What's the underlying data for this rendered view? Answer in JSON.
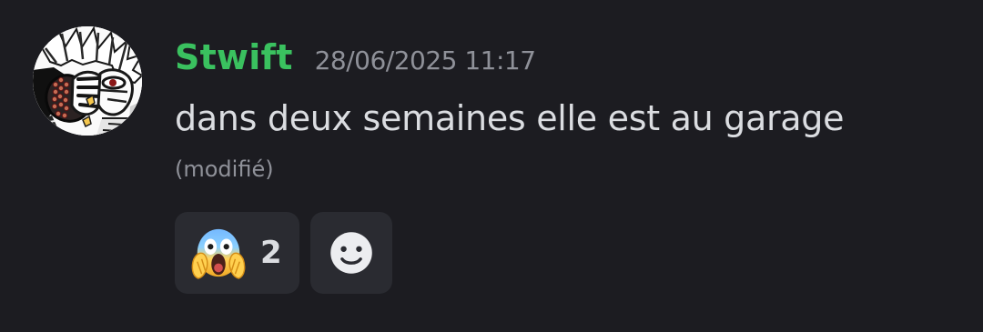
{
  "message": {
    "author": "Stwift",
    "timestamp": "28/06/2025 11:17",
    "text": "dans deux semaines elle est au garage",
    "edited_label": "(modifié)",
    "avatar_icon": "manga-avatar-icon"
  },
  "reactions": [
    {
      "emoji": "screaming-face-icon",
      "count": "2"
    }
  ],
  "add_reaction": {
    "icon": "add-reaction-smile-icon"
  },
  "colors": {
    "background": "#1c1c21",
    "username": "#3ac15f",
    "text": "#dbdde1",
    "muted": "#8f9199",
    "reaction_background": "#2a2b31"
  }
}
